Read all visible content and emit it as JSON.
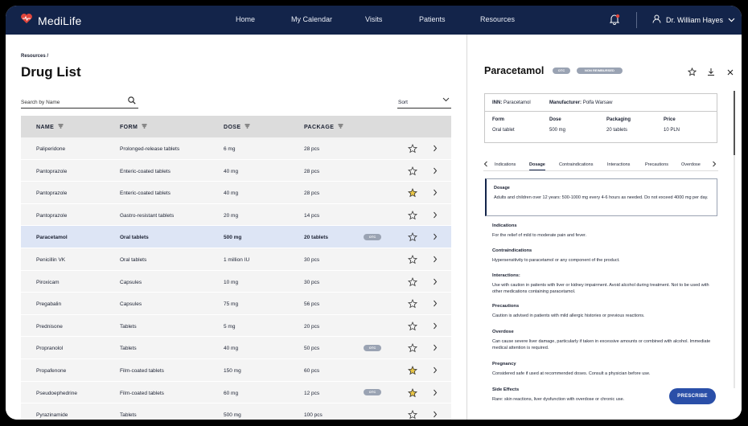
{
  "app": {
    "name": "MediLife"
  },
  "nav": {
    "items": [
      "Home",
      "My Calendar",
      "Visits",
      "Patients",
      "Resources"
    ]
  },
  "user": {
    "name": "Dr. William Hayes"
  },
  "colors": {
    "navbar": "#13244a",
    "accent": "#2a4fa8",
    "selected_row": "#dde5f5",
    "favorite_star": "#e8c547",
    "notification": "#e0463c"
  },
  "breadcrumb": "Resources /",
  "page": {
    "title": "Drug List"
  },
  "search": {
    "placeholder": "Search by Name"
  },
  "sort": {
    "label": "Sort"
  },
  "table": {
    "columns": [
      "NAME",
      "FORM",
      "DOSE",
      "PACKAGE"
    ],
    "rows": [
      {
        "name": "Paliperidone",
        "form": "Prolonged-release tablets",
        "dose": "6 mg",
        "package": "28 pcs",
        "badge": "",
        "favorite": false
      },
      {
        "name": "Pantoprazole",
        "form": "Enteric-coated tablets",
        "dose": "40 mg",
        "package": "28 pcs",
        "badge": "",
        "favorite": false
      },
      {
        "name": "Pantoprazole",
        "form": "Enteric-coated tablets",
        "dose": "40 mg",
        "package": "28 pcs",
        "badge": "",
        "favorite": true
      },
      {
        "name": "Pantoprazole",
        "form": "Gastro-resistant tablets",
        "dose": "20 mg",
        "package": "14 pcs",
        "badge": "",
        "favorite": false
      },
      {
        "name": "Paracetamol",
        "form": "Oral tablets",
        "dose": "500 mg",
        "package": "20 tablets",
        "badge": "OTC",
        "favorite": false,
        "selected": true
      },
      {
        "name": "Penicillin VK",
        "form": "Oral tablets",
        "dose": "1 million IU",
        "package": "30 pcs",
        "badge": "",
        "favorite": false
      },
      {
        "name": "Piroxicam",
        "form": "Capsules",
        "dose": "10 mg",
        "package": "30 pcs",
        "badge": "",
        "favorite": false
      },
      {
        "name": "Pregabalin",
        "form": "Capsules",
        "dose": "75 mg",
        "package": "56 pcs",
        "badge": "",
        "favorite": false
      },
      {
        "name": "Prednisone",
        "form": "Tablets",
        "dose": "5 mg",
        "package": "20 pcs",
        "badge": "",
        "favorite": false
      },
      {
        "name": "Propranolol",
        "form": "Tablets",
        "dose": "40 mg",
        "package": "50 pcs",
        "badge": "OTC",
        "favorite": false
      },
      {
        "name": "Propafenone",
        "form": "Film-coated tablets",
        "dose": "150 mg",
        "package": "60 pcs",
        "badge": "",
        "favorite": true
      },
      {
        "name": "Pseudoephedrine",
        "form": "Film-coated tablets",
        "dose": "60 mg",
        "package": "12 pcs",
        "badge": "OTC",
        "favorite": true
      },
      {
        "name": "Pyrazinamide",
        "form": "Tablets",
        "dose": "500 mg",
        "package": "100 pcs",
        "badge": "",
        "favorite": false
      }
    ]
  },
  "detail": {
    "title": "Paracetamol",
    "badges": [
      "OTC",
      "NON REIMBURSED"
    ],
    "inn_label": "INN:",
    "inn": "Paracetamol",
    "manufacturer_label": "Manufacturer:",
    "manufacturer": "Polfa Warsaw",
    "fields": [
      {
        "label": "Form",
        "value": "Oral tablet"
      },
      {
        "label": "Dose",
        "value": "500 mg"
      },
      {
        "label": "Packaging",
        "value": "20 tablets"
      },
      {
        "label": "Price",
        "value": "10 PLN"
      }
    ],
    "tabs": [
      "Indications",
      "Dosage",
      "Contraindications",
      "Interactions",
      "Precautions",
      "Overdose"
    ],
    "active_tab": "Dosage",
    "dosage": {
      "title": "Dosage",
      "text": "Adults and children over 12 years: 500-1000 mg every 4-6 hours as needed. Do not exceed 4000 mg per day."
    },
    "sections": [
      {
        "title": "Indications",
        "text": "For the relief of mild to moderate pain and fever."
      },
      {
        "title": "Contraindications",
        "text": "Hypersensitivity to paracetamol or any component of the product."
      },
      {
        "title": "Interactions:",
        "text": "Use with caution in patients with liver or kidney impairment. Avoid alcohol during treatment. Not to be used with other medications containing paracetamol."
      },
      {
        "title": "Precautions",
        "text": "Caution is advised in patients with mild allergic histories or previous reactions."
      },
      {
        "title": "Overdose",
        "text": "Can cause severe liver damage, particularly if taken in excessive amounts or combined with alcohol. Immediate medical attention is required."
      },
      {
        "title": "Pregnancy",
        "text": "Considered safe if used at recommended doses. Consult a physician before use."
      },
      {
        "title": "Side Effects",
        "text": "Rare: skin reactions, liver dysfunction with overdose or chronic use."
      }
    ],
    "prescribe_label": "PRESCRIBE"
  }
}
